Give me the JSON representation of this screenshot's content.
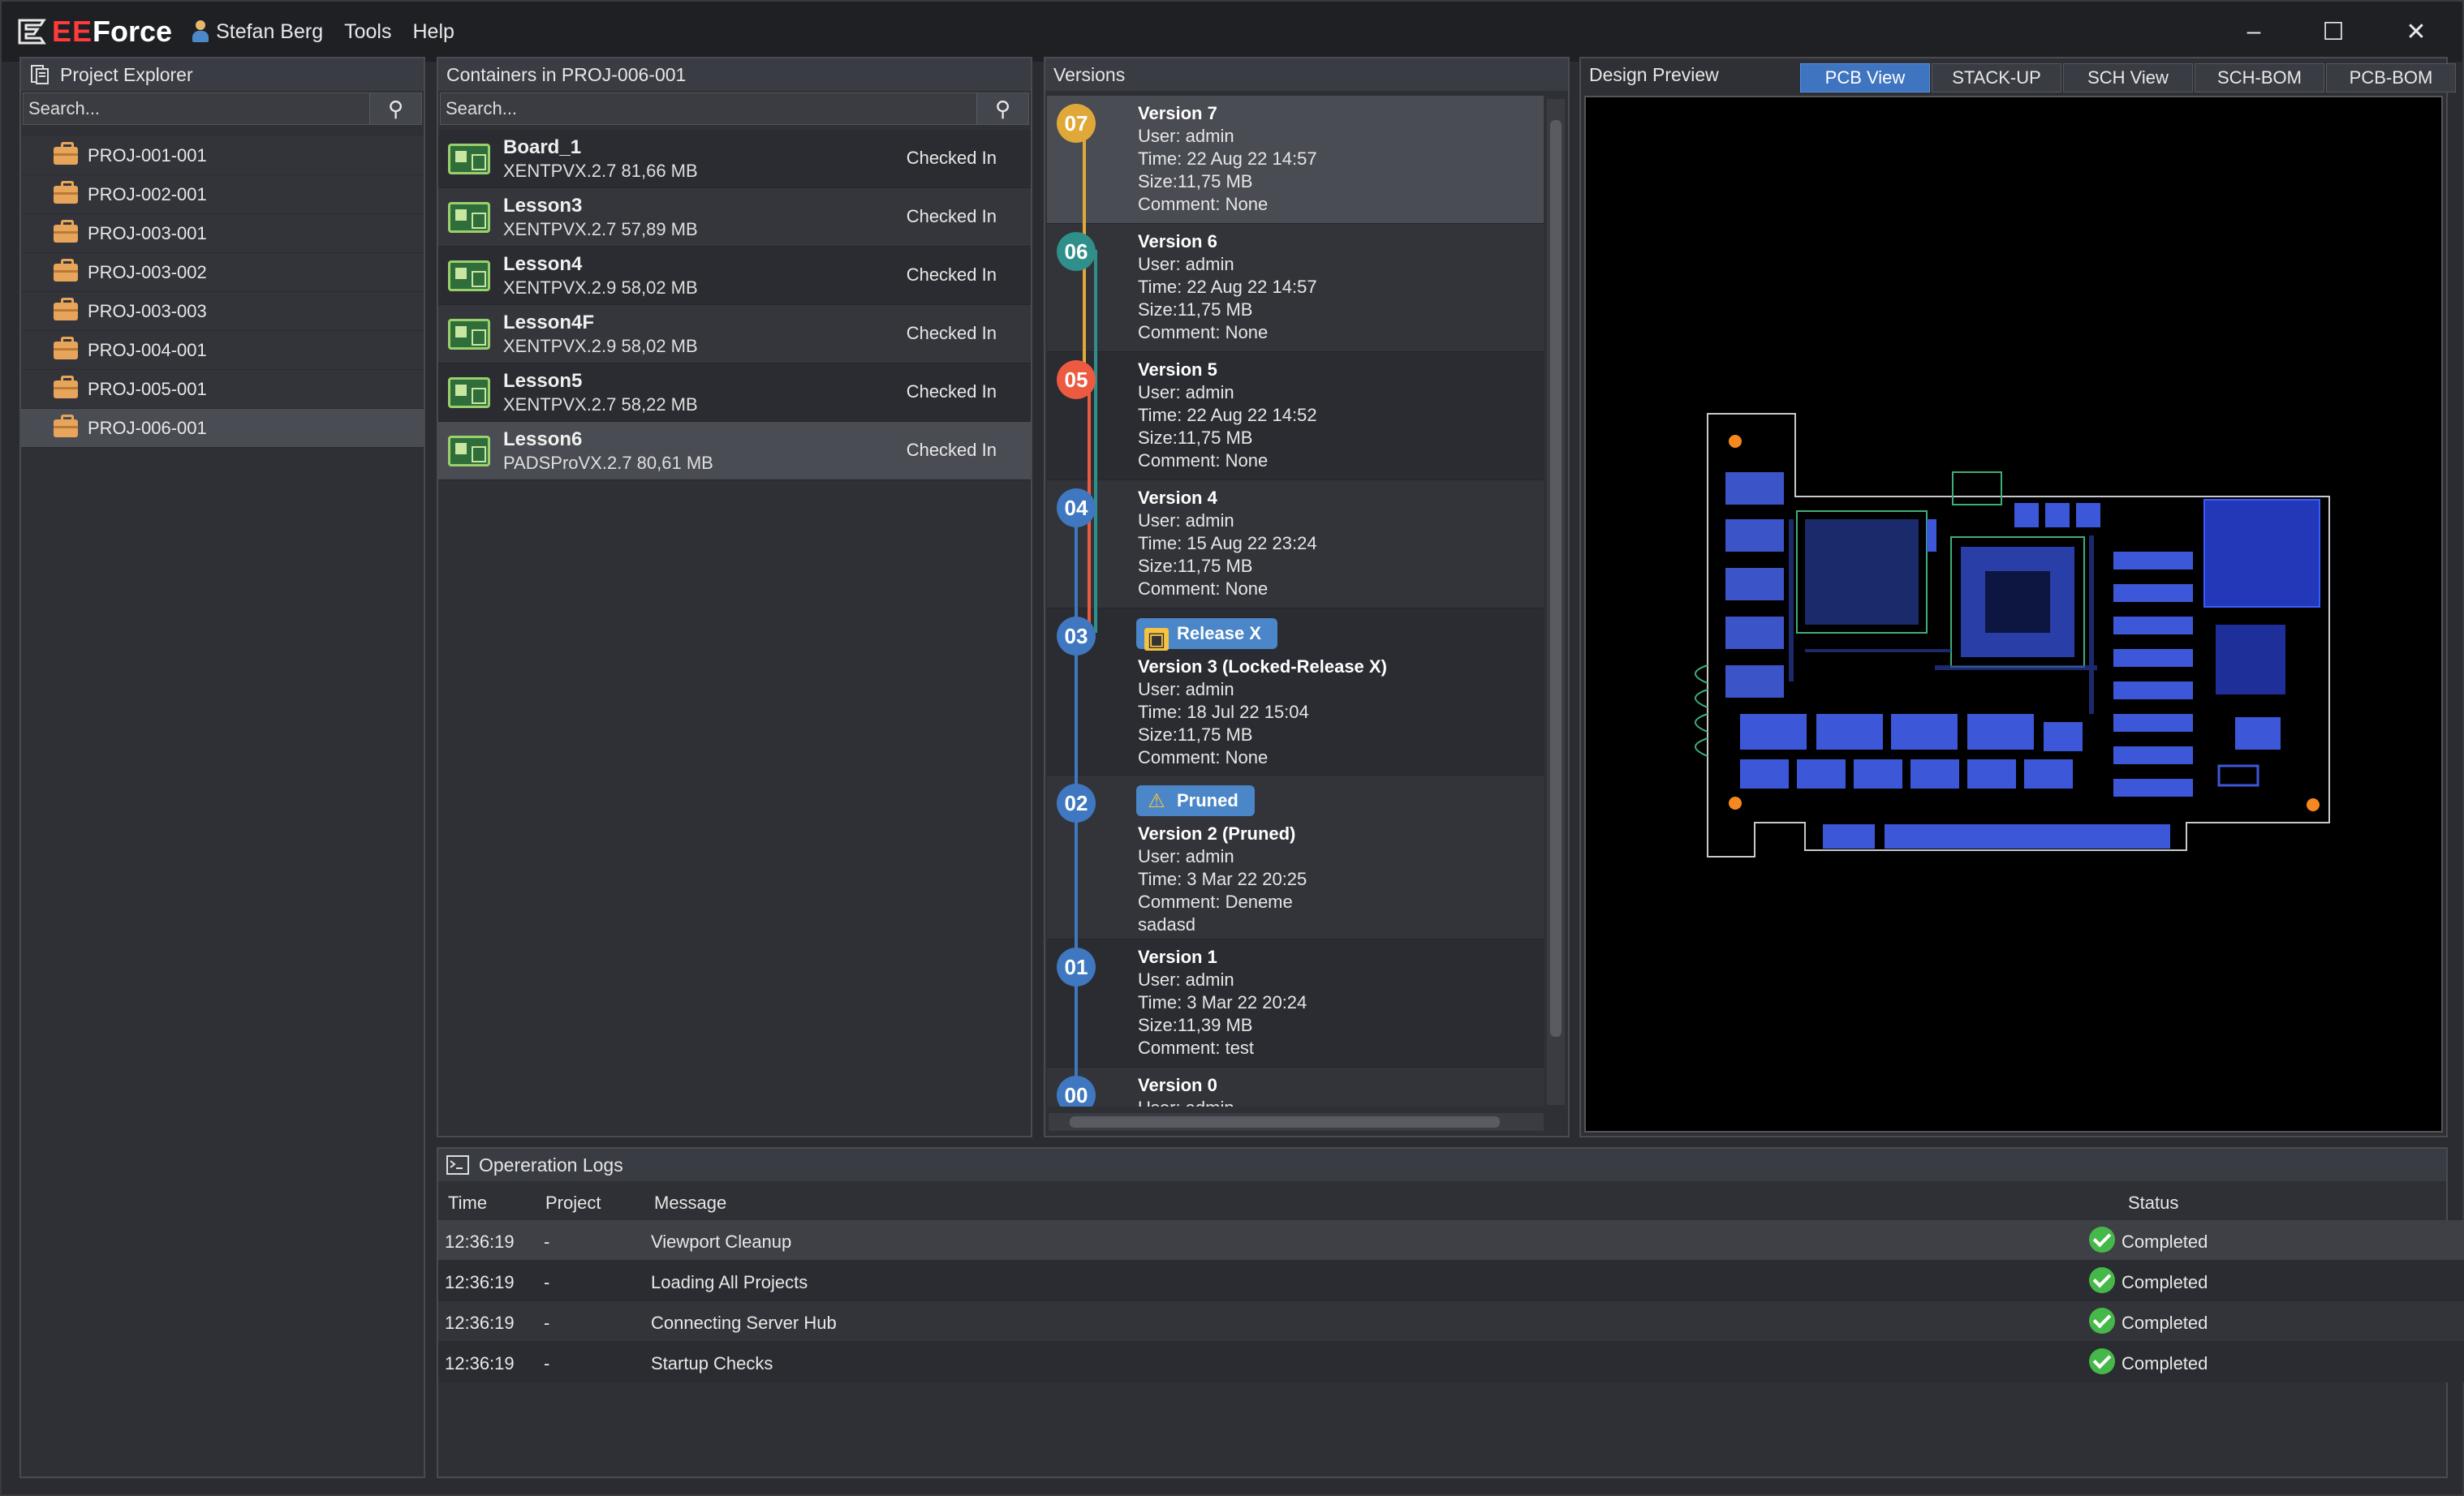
{
  "app": {
    "logo_ee": "EE",
    "logo_force": "Force",
    "user": "Stefan Berg"
  },
  "menu": {
    "tools": "Tools",
    "help": "Help"
  },
  "window_controls": {
    "minimize": "–",
    "maximize": "☐",
    "close": "✕"
  },
  "project_explorer": {
    "title": "Project Explorer",
    "search_placeholder": "Search...",
    "projects": [
      "PROJ-001-001",
      "PROJ-002-001",
      "PROJ-003-001",
      "PROJ-003-002",
      "PROJ-003-003",
      "PROJ-004-001",
      "PROJ-005-001",
      "PROJ-006-001"
    ],
    "selected": "PROJ-006-001"
  },
  "containers": {
    "title": "Containers in PROJ-006-001",
    "search_placeholder": "Search...",
    "items": [
      {
        "name": "Board_1",
        "info": "XENTPVX.2.7 81,66 MB",
        "status": "Checked In"
      },
      {
        "name": "Lesson3",
        "info": "XENTPVX.2.7 57,89 MB",
        "status": "Checked In"
      },
      {
        "name": "Lesson4",
        "info": "XENTPVX.2.9 58,02 MB",
        "status": "Checked In"
      },
      {
        "name": "Lesson4F",
        "info": "XENTPVX.2.9 58,02 MB",
        "status": "Checked In"
      },
      {
        "name": "Lesson5",
        "info": "XENTPVX.2.7 58,22 MB",
        "status": "Checked In"
      },
      {
        "name": "Lesson6",
        "info": "PADSProVX.2.7 80,61 MB",
        "status": "Checked In"
      }
    ]
  },
  "versions": {
    "title": "Versions",
    "items": [
      {
        "node": "07",
        "color": "#e0a838",
        "title": "Version 7",
        "user": "User: admin",
        "time": "Time: 22 Aug 22 14:57",
        "size": "Size:11,75 MB",
        "comment": "Comment: None"
      },
      {
        "node": "06",
        "color": "#2f8f8a",
        "title": "Version 6",
        "user": "User: admin",
        "time": "Time: 22 Aug 22 14:57",
        "size": "Size:11,75 MB",
        "comment": "Comment: None"
      },
      {
        "node": "05",
        "color": "#ec5a3f",
        "title": "Version 5",
        "user": "User: admin",
        "time": "Time: 22 Aug 22 14:52",
        "size": "Size:11,75 MB",
        "comment": "Comment: None"
      },
      {
        "node": "04",
        "color": "#3f78c0",
        "title": "Version 4",
        "user": "User: admin",
        "time": "Time: 15 Aug 22 23:24",
        "size": "Size:11,75 MB",
        "comment": "Comment: None"
      },
      {
        "node": "03",
        "color": "#3f78c0",
        "badge": "Release X",
        "title": "Version 3 (Locked-Release X)",
        "user": "User: admin",
        "time": "Time: 18 Jul 22 15:04",
        "size": "Size:11,75 MB",
        "comment": "Comment: None"
      },
      {
        "node": "02",
        "color": "#3f78c0",
        "badge": "Pruned",
        "title": "Version 2 (Pruned)",
        "user": "User: admin",
        "time": "Time: 3 Mar 22 20:25",
        "comment": "Comment: Deneme",
        "comment2": "sadasd"
      },
      {
        "node": "01",
        "color": "#3f78c0",
        "title": "Version 1",
        "user": "User: admin",
        "time": "Time: 3 Mar 22 20:24",
        "size": "Size:11,39 MB",
        "comment": "Comment: test"
      },
      {
        "node": "00",
        "color": "#3f78c0",
        "title": "Version 0",
        "user": "User: admin"
      }
    ]
  },
  "preview": {
    "title": "Design Preview",
    "tabs": [
      "PCB View",
      "STACK-UP",
      "SCH View",
      "SCH-BOM",
      "PCB-BOM"
    ],
    "active_tab": "PCB View"
  },
  "logs": {
    "title": "Opereration Logs",
    "columns": {
      "time": "Time",
      "project": "Project",
      "message": "Message",
      "status": "Status"
    },
    "rows": [
      {
        "time": "12:36:19",
        "project": "-",
        "message": "Viewport Cleanup",
        "status": "Completed"
      },
      {
        "time": "12:36:19",
        "project": "-",
        "message": "Loading All Projects",
        "status": "Completed"
      },
      {
        "time": "12:36:19",
        "project": "-",
        "message": "Connecting Server Hub",
        "status": "Completed"
      },
      {
        "time": "12:36:19",
        "project": "-",
        "message": "Startup Checks",
        "status": "Completed"
      }
    ]
  }
}
